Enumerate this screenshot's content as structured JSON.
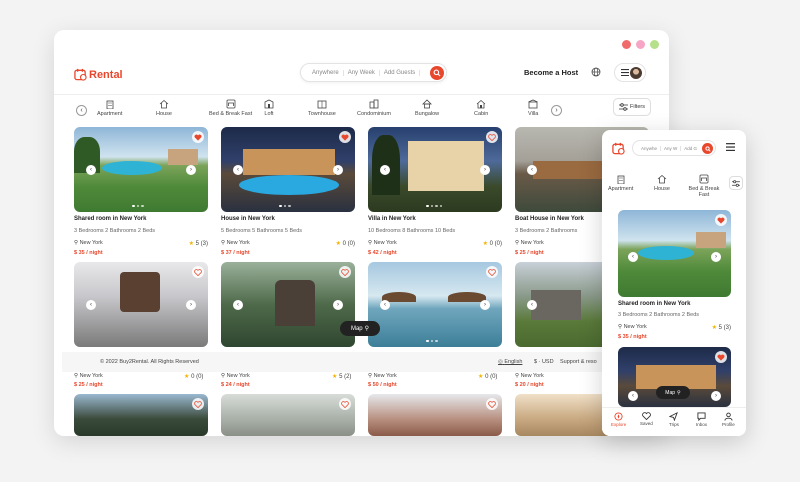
{
  "colors": {
    "accent": "#e8472d",
    "dot_red": "#f06b6b",
    "dot_pink": "#f6a6c4",
    "dot_green": "#b6e08a"
  },
  "header": {
    "logo": "Rental",
    "search": {
      "anywhere": "Anywhere",
      "any_week": "Any Week",
      "add_guests": "Add Guests"
    },
    "become_host": "Become a Host"
  },
  "categories": [
    "Apartment",
    "House",
    "Bed & Break Fast",
    "Loft",
    "Townhouse",
    "Condominium",
    "Bungalow",
    "Cabin",
    "Villa"
  ],
  "filters_label": "Filters",
  "listings": [
    {
      "title": "Shared room in New York",
      "meta": "3 Bedrooms  2 Bathrooms  2 Beds",
      "location": "New York",
      "rating": "5 (3)",
      "price": "$ 35 / night",
      "fav": true
    },
    {
      "title": "House in New York",
      "meta": "5 Bedrooms  5 Bathrooms  5 Beds",
      "location": "New York",
      "rating": "0 (0)",
      "price": "$ 37 / night",
      "fav": true
    },
    {
      "title": "Villa in New York",
      "meta": "10 Bedrooms  8 Bathrooms  10 Beds",
      "location": "New York",
      "rating": "0 (0)",
      "price": "$ 42 / night",
      "fav": false
    },
    {
      "title": "Boat House in New York",
      "meta": "3 Bedrooms  2 Bathrooms",
      "location": "New York",
      "rating": "",
      "price": "$ 25 / night",
      "fav": false
    },
    {
      "location": "New York",
      "rating": "0 (0)",
      "price": "$ 25 / night",
      "fav": false
    },
    {
      "location": "New York",
      "rating": "5 (2)",
      "price": "$ 24 / night",
      "fav": false
    },
    {
      "location": "New York",
      "rating": "0 (0)",
      "price": "$ 50 / night",
      "fav": false
    },
    {
      "location": "New York",
      "rating": "",
      "price": "$ 20 / night",
      "fav": false
    }
  ],
  "map_label": "Map",
  "footer": {
    "copyright": "© 2022 Buy2Rental. All Rights Reserved",
    "language": "English",
    "currency": "$ · USD",
    "support": "Support & reso"
  },
  "mobile": {
    "search": {
      "anywhere": "Anywhe",
      "any_week": "Any W",
      "add_guests": "Add G"
    },
    "categories": [
      "Apartment",
      "House",
      "Bed & Break Fast"
    ],
    "listing": {
      "title": "Shared room in New York",
      "meta": "3 Bedrooms  2 Bathrooms  2 Beds",
      "location": "New York",
      "rating": "5 (3)",
      "price": "$ 35 / night"
    },
    "map_label": "Map",
    "tabs": [
      "Explore",
      "Saved",
      "Trips",
      "Inbox",
      "Profile"
    ]
  }
}
